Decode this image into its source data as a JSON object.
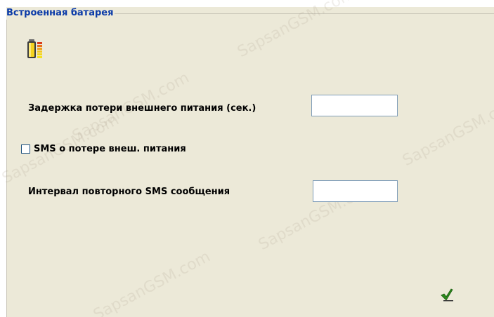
{
  "group": {
    "title": "Встроенная батарея"
  },
  "fields": {
    "power_loss_delay": {
      "label": "Задержка потери внешнего питания (сек.)",
      "value": ""
    },
    "sms_on_loss": {
      "label": "SMS о потере внеш. питания",
      "checked": false
    },
    "repeat_sms_interval": {
      "label": "Интервал повторного SMS сообщения",
      "value": ""
    }
  },
  "icons": {
    "battery": "battery-icon",
    "apply": "checkmark-icon"
  },
  "colors": {
    "panel_bg": "#ece9d8",
    "title_blue": "#0a3aa8",
    "check_green": "#2a8a1a"
  },
  "watermark": {
    "text_1": "SapsanGSM.com",
    "text_2": "SapsanGSM.com",
    "text_3": "SapsanGSM.com",
    "text_4": "SapsanGSM.com",
    "text_5": "SapsanGSM.com",
    "text_6": "SapsanGSM.com"
  }
}
